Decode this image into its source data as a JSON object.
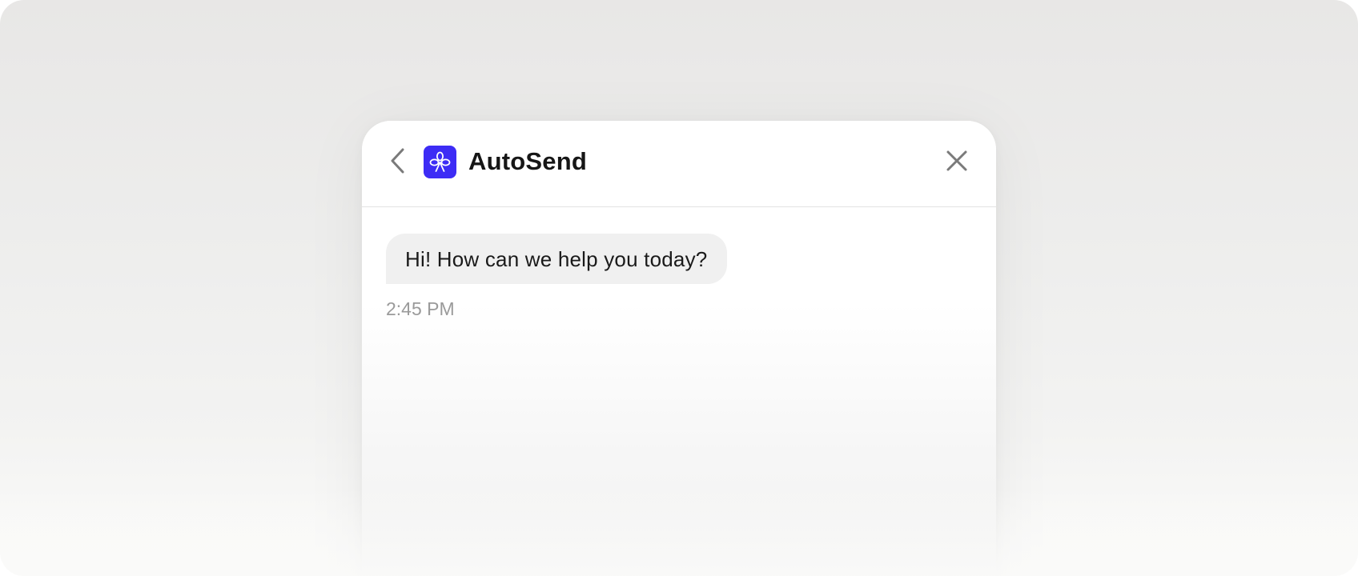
{
  "header": {
    "back_icon": "chevron-left-icon",
    "logo_icon": "autosend-logo-icon",
    "app_name": "AutoSend",
    "close_icon": "close-icon"
  },
  "messages": [
    {
      "text": "Hi! How can we help you today?",
      "time": "2:45 PM"
    }
  ],
  "colors": {
    "brand": "#3d2cf5",
    "bubble": "#f0f0f0",
    "timestamp": "#9a9a9a"
  }
}
